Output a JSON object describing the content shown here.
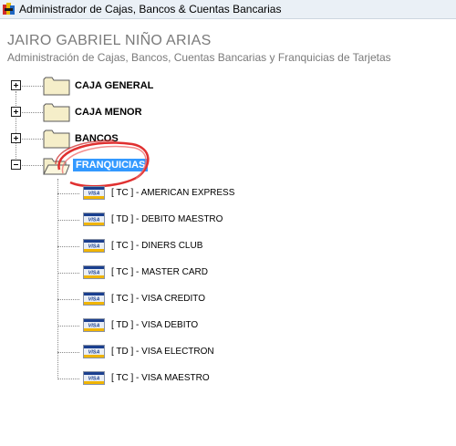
{
  "window": {
    "title": "Administrador de Cajas, Bancos & Cuentas Bancarias"
  },
  "header": {
    "name": "JAIRO GABRIEL NIÑO ARIAS",
    "subtitle": "Administración de Cajas, Bancos, Cuentas Bancarias y Franquicias de Tarjetas"
  },
  "tree": {
    "nodes": [
      {
        "label": "CAJA GENERAL",
        "expanded": false
      },
      {
        "label": "CAJA MENOR",
        "expanded": false
      },
      {
        "label": "BANCOS",
        "expanded": false
      },
      {
        "label": "FRANQUICIAS",
        "expanded": true,
        "selected": true
      }
    ],
    "franquicias": [
      {
        "label": "[ TC ] - AMERICAN EXPRESS",
        "icon": "visa-card-icon"
      },
      {
        "label": "[ TD ] - DEBITO MAESTRO",
        "icon": "visa-card-icon"
      },
      {
        "label": "[ TC ] - DINERS CLUB",
        "icon": "visa-card-icon"
      },
      {
        "label": "[ TC ] - MASTER CARD",
        "icon": "visa-card-icon"
      },
      {
        "label": "[ TC ] - VISA CREDITO",
        "icon": "visa-card-icon"
      },
      {
        "label": "[ TD ] - VISA DEBITO",
        "icon": "visa-card-icon"
      },
      {
        "label": "[ TD ] - VISA ELECTRON",
        "icon": "visa-card-icon"
      },
      {
        "label": "[ TC ] - VISA MAESTRO",
        "icon": "visa-card-icon"
      }
    ],
    "card_brand_text": "VISA"
  },
  "colors": {
    "selection": "#3399ff",
    "header_text": "#7a7a7a",
    "folder_fill": "#f5eec9",
    "highlight_ring": "#e03030"
  }
}
